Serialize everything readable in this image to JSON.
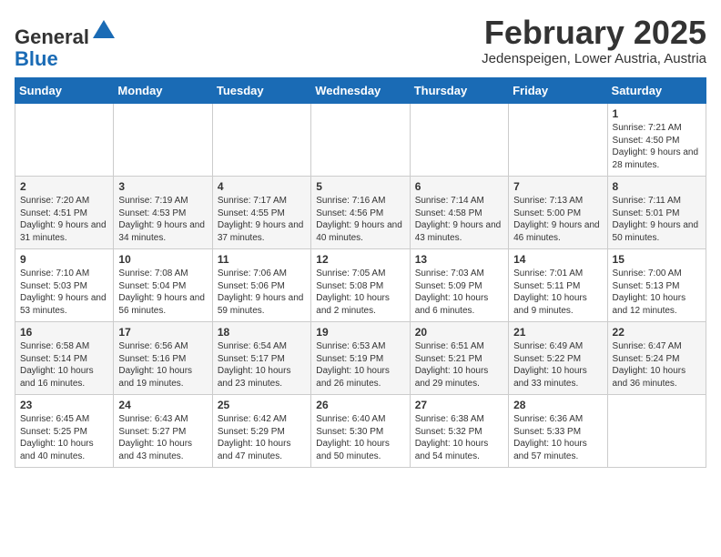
{
  "header": {
    "logo_general": "General",
    "logo_blue": "Blue",
    "month_title": "February 2025",
    "location": "Jedenspeigen, Lower Austria, Austria"
  },
  "weekdays": [
    "Sunday",
    "Monday",
    "Tuesday",
    "Wednesday",
    "Thursday",
    "Friday",
    "Saturday"
  ],
  "weeks": [
    [
      {
        "day": "",
        "info": ""
      },
      {
        "day": "",
        "info": ""
      },
      {
        "day": "",
        "info": ""
      },
      {
        "day": "",
        "info": ""
      },
      {
        "day": "",
        "info": ""
      },
      {
        "day": "",
        "info": ""
      },
      {
        "day": "1",
        "info": "Sunrise: 7:21 AM\nSunset: 4:50 PM\nDaylight: 9 hours and 28 minutes."
      }
    ],
    [
      {
        "day": "2",
        "info": "Sunrise: 7:20 AM\nSunset: 4:51 PM\nDaylight: 9 hours and 31 minutes."
      },
      {
        "day": "3",
        "info": "Sunrise: 7:19 AM\nSunset: 4:53 PM\nDaylight: 9 hours and 34 minutes."
      },
      {
        "day": "4",
        "info": "Sunrise: 7:17 AM\nSunset: 4:55 PM\nDaylight: 9 hours and 37 minutes."
      },
      {
        "day": "5",
        "info": "Sunrise: 7:16 AM\nSunset: 4:56 PM\nDaylight: 9 hours and 40 minutes."
      },
      {
        "day": "6",
        "info": "Sunrise: 7:14 AM\nSunset: 4:58 PM\nDaylight: 9 hours and 43 minutes."
      },
      {
        "day": "7",
        "info": "Sunrise: 7:13 AM\nSunset: 5:00 PM\nDaylight: 9 hours and 46 minutes."
      },
      {
        "day": "8",
        "info": "Sunrise: 7:11 AM\nSunset: 5:01 PM\nDaylight: 9 hours and 50 minutes."
      }
    ],
    [
      {
        "day": "9",
        "info": "Sunrise: 7:10 AM\nSunset: 5:03 PM\nDaylight: 9 hours and 53 minutes."
      },
      {
        "day": "10",
        "info": "Sunrise: 7:08 AM\nSunset: 5:04 PM\nDaylight: 9 hours and 56 minutes."
      },
      {
        "day": "11",
        "info": "Sunrise: 7:06 AM\nSunset: 5:06 PM\nDaylight: 9 hours and 59 minutes."
      },
      {
        "day": "12",
        "info": "Sunrise: 7:05 AM\nSunset: 5:08 PM\nDaylight: 10 hours and 2 minutes."
      },
      {
        "day": "13",
        "info": "Sunrise: 7:03 AM\nSunset: 5:09 PM\nDaylight: 10 hours and 6 minutes."
      },
      {
        "day": "14",
        "info": "Sunrise: 7:01 AM\nSunset: 5:11 PM\nDaylight: 10 hours and 9 minutes."
      },
      {
        "day": "15",
        "info": "Sunrise: 7:00 AM\nSunset: 5:13 PM\nDaylight: 10 hours and 12 minutes."
      }
    ],
    [
      {
        "day": "16",
        "info": "Sunrise: 6:58 AM\nSunset: 5:14 PM\nDaylight: 10 hours and 16 minutes."
      },
      {
        "day": "17",
        "info": "Sunrise: 6:56 AM\nSunset: 5:16 PM\nDaylight: 10 hours and 19 minutes."
      },
      {
        "day": "18",
        "info": "Sunrise: 6:54 AM\nSunset: 5:17 PM\nDaylight: 10 hours and 23 minutes."
      },
      {
        "day": "19",
        "info": "Sunrise: 6:53 AM\nSunset: 5:19 PM\nDaylight: 10 hours and 26 minutes."
      },
      {
        "day": "20",
        "info": "Sunrise: 6:51 AM\nSunset: 5:21 PM\nDaylight: 10 hours and 29 minutes."
      },
      {
        "day": "21",
        "info": "Sunrise: 6:49 AM\nSunset: 5:22 PM\nDaylight: 10 hours and 33 minutes."
      },
      {
        "day": "22",
        "info": "Sunrise: 6:47 AM\nSunset: 5:24 PM\nDaylight: 10 hours and 36 minutes."
      }
    ],
    [
      {
        "day": "23",
        "info": "Sunrise: 6:45 AM\nSunset: 5:25 PM\nDaylight: 10 hours and 40 minutes."
      },
      {
        "day": "24",
        "info": "Sunrise: 6:43 AM\nSunset: 5:27 PM\nDaylight: 10 hours and 43 minutes."
      },
      {
        "day": "25",
        "info": "Sunrise: 6:42 AM\nSunset: 5:29 PM\nDaylight: 10 hours and 47 minutes."
      },
      {
        "day": "26",
        "info": "Sunrise: 6:40 AM\nSunset: 5:30 PM\nDaylight: 10 hours and 50 minutes."
      },
      {
        "day": "27",
        "info": "Sunrise: 6:38 AM\nSunset: 5:32 PM\nDaylight: 10 hours and 54 minutes."
      },
      {
        "day": "28",
        "info": "Sunrise: 6:36 AM\nSunset: 5:33 PM\nDaylight: 10 hours and 57 minutes."
      },
      {
        "day": "",
        "info": ""
      }
    ]
  ]
}
